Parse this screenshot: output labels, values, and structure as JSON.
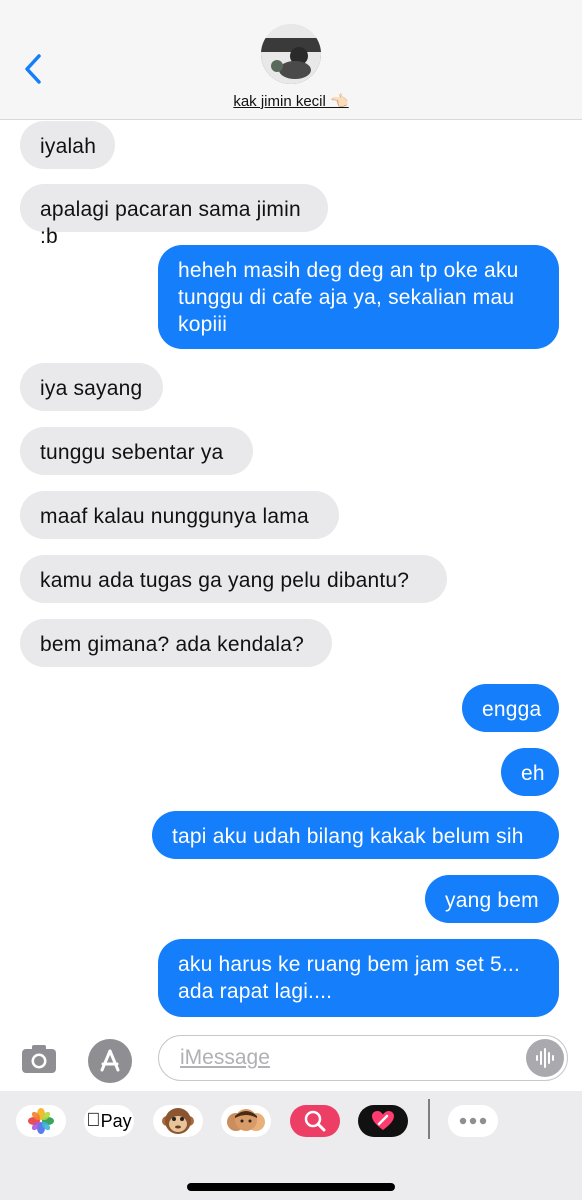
{
  "header": {
    "contact_name": "kak jimin kecil 👈🏻"
  },
  "messages": [
    {
      "dir": "in",
      "text": "iyalah"
    },
    {
      "dir": "in",
      "text": "apalagi pacaran sama jimin :b"
    },
    {
      "dir": "out",
      "text": "heheh masih deg deg an tp oke aku tunggu di cafe aja ya, sekalian mau kopiii"
    },
    {
      "dir": "in",
      "text": "iya sayang"
    },
    {
      "dir": "in",
      "text": "tunggu sebentar ya"
    },
    {
      "dir": "in",
      "text": "maaf kalau nunggunya lama"
    },
    {
      "dir": "in",
      "text": "kamu ada tugas ga yang pelu dibantu?"
    },
    {
      "dir": "in",
      "text": "bem gimana? ada kendala?"
    },
    {
      "dir": "out",
      "text": "engga"
    },
    {
      "dir": "out",
      "text": "eh"
    },
    {
      "dir": "out",
      "text": "tapi aku udah bilang kakak belum sih"
    },
    {
      "dir": "out",
      "text": "yang bem"
    },
    {
      "dir": "out",
      "text": "aku harus ke ruang bem jam set 5... ada rapat lagi...."
    }
  ],
  "compose": {
    "placeholder": "iMessage"
  },
  "apps": [
    {
      "name": "photos",
      "label": ""
    },
    {
      "name": "apple-pay",
      "label": "Pay"
    },
    {
      "name": "animoji",
      "label": ""
    },
    {
      "name": "memoji",
      "label": ""
    },
    {
      "name": "image-search",
      "label": ""
    },
    {
      "name": "digital-touch",
      "label": ""
    },
    {
      "name": "more",
      "label": ""
    }
  ],
  "colors": {
    "outgoing": "#147efb",
    "incoming": "#e9e9eb",
    "accent": "#147efb"
  }
}
